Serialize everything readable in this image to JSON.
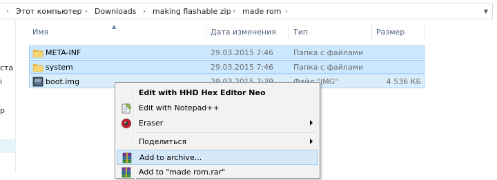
{
  "breadcrumb": {
    "items": [
      "Этот компьютер",
      "Downloads",
      "making flashable zip",
      "made rom"
    ],
    "separator": "›"
  },
  "navpane": {
    "fragments": [
      "ста",
      "і",
      "р"
    ]
  },
  "columns": {
    "name": "Имя",
    "date": "Дата изменения",
    "type": "Тип",
    "size": "Размер"
  },
  "files": [
    {
      "name": "META-INF",
      "date": "29.03.2015 7:46",
      "type": "Папка с файлами",
      "size": "",
      "icon": "folder-icon"
    },
    {
      "name": "system",
      "date": "29.03.2015 7:46",
      "type": "Папка с файлами",
      "size": "",
      "icon": "folder-icon"
    },
    {
      "name": "boot.img",
      "date": "29.03.2015 7:39",
      "type": "Файл \"IMG\"",
      "size": "4 536 КБ",
      "icon": "img-file-icon"
    }
  ],
  "context_menu": {
    "items": [
      {
        "label": "Edit with HHD Hex Editor Neo",
        "bold": true,
        "icon": "",
        "submenu": false
      },
      {
        "label": "Edit with Notepad++",
        "bold": false,
        "icon": "notepad-icon",
        "submenu": false
      },
      {
        "label": "Eraser",
        "bold": false,
        "icon": "eraser-icon",
        "submenu": true
      },
      {
        "label": "Поделиться",
        "bold": false,
        "icon": "",
        "submenu": true
      },
      {
        "label": "Add to archive...",
        "bold": false,
        "icon": "winrar-icon",
        "submenu": false,
        "highlighted": true
      },
      {
        "label": "Add to \"made rom.rar\"",
        "bold": false,
        "icon": "winrar-icon",
        "submenu": false
      }
    ]
  },
  "colors": {
    "selection": "#cce8ff",
    "selection_border": "#99d1ff",
    "header_text": "#4c607a",
    "muted_text": "#6d6d6d",
    "menu_bg": "#f2f2f2"
  }
}
